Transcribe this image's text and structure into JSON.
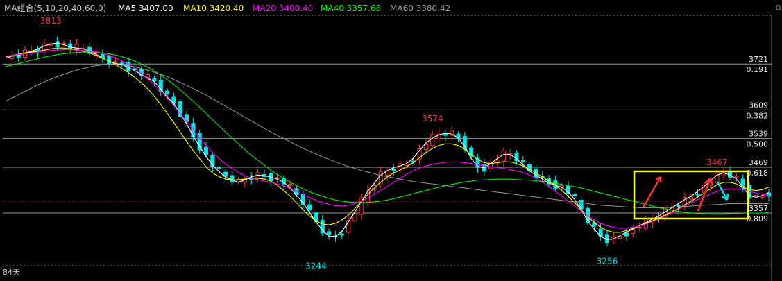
{
  "legend": {
    "title": "MA组合(5,10,20,40,60,0)",
    "items": [
      {
        "label": "MA5 3407.00",
        "color": "#ffffff"
      },
      {
        "label": "MA10 3420.40",
        "color": "#ffff00"
      },
      {
        "label": "MA20 3400.40",
        "color": "#ff00ff"
      },
      {
        "label": "MA40 3357.68",
        "color": "#00ff00"
      },
      {
        "label": "MA60 3380.42",
        "color": "#9a9a9a"
      }
    ]
  },
  "period_label": "84天",
  "colors": {
    "up": "#ff3232",
    "down": "#00e5e5",
    "grid": "#9a9a9a",
    "highlight": "#ffff00",
    "peak_label": "#ff3232",
    "trough_label": "#00e5e5"
  },
  "levels": [
    {
      "price": 3721,
      "ratio": "0.191"
    },
    {
      "price": 3609,
      "ratio": "0.382"
    },
    {
      "price": 3539,
      "ratio": "0.500"
    },
    {
      "price": 3469,
      "ratio": "0.618"
    },
    {
      "price": 3357,
      "ratio": "0.809"
    }
  ],
  "annotations": [
    {
      "text": "3813",
      "x": 8,
      "y": 3813,
      "kind": "peak"
    },
    {
      "text": "3574",
      "x": 67,
      "y": 3574,
      "kind": "peak"
    },
    {
      "text": "3467",
      "x": 111,
      "y": 3467,
      "kind": "peak"
    },
    {
      "text": "3244",
      "x": 49,
      "y": 3244,
      "kind": "trough"
    },
    {
      "text": "3256",
      "x": 94,
      "y": 3256,
      "kind": "trough"
    }
  ],
  "chart_data": {
    "type": "line",
    "title": "",
    "xlabel": "",
    "ylabel": "",
    "ylim": [
      3230,
      3840
    ],
    "grid": true,
    "legend_position": "top-left",
    "x": [
      1,
      2,
      3,
      4,
      5,
      6,
      7,
      8,
      9,
      10,
      11,
      12,
      13,
      14,
      15,
      16,
      17,
      18,
      19,
      20,
      21,
      22,
      23,
      24,
      25,
      26,
      27,
      28,
      29,
      30,
      31,
      32,
      33,
      34,
      35,
      36,
      37,
      38,
      39,
      40,
      41,
      42,
      43,
      44,
      45,
      46,
      47,
      48,
      49,
      50,
      51,
      52,
      53,
      54,
      55,
      56,
      57,
      58,
      59,
      60,
      61,
      62,
      63,
      64,
      65,
      66,
      67,
      68,
      69,
      70,
      71,
      72,
      73,
      74,
      75,
      76,
      77,
      78,
      79,
      80,
      81,
      82,
      83,
      84,
      85,
      86,
      87,
      88,
      89,
      90,
      91,
      92,
      93,
      94,
      95,
      96,
      97,
      98,
      99,
      100,
      101,
      102,
      103,
      104,
      105,
      106,
      107,
      108,
      109,
      110,
      111,
      112,
      113,
      114,
      115,
      116,
      117,
      118,
      119
    ],
    "series": [
      {
        "name": "MA5",
        "values": [
          3735,
          3740,
          3742,
          3748,
          3752,
          3758,
          3765,
          3770,
          3772,
          3768,
          3762,
          3760,
          3758,
          3752,
          3745,
          3735,
          3728,
          3722,
          3720,
          3712,
          3705,
          3695,
          3686,
          3678,
          3660,
          3640,
          3625,
          3600,
          3575,
          3545,
          3520,
          3495,
          3475,
          3458,
          3445,
          3438,
          3432,
          3438,
          3445,
          3450,
          3448,
          3445,
          3440,
          3432,
          3418,
          3400,
          3382,
          3358,
          3335,
          3315,
          3300,
          3300,
          3312,
          3335,
          3360,
          3385,
          3410,
          3430,
          3450,
          3460,
          3468,
          3472,
          3478,
          3490,
          3510,
          3528,
          3540,
          3548,
          3552,
          3550,
          3540,
          3520,
          3490,
          3470,
          3468,
          3478,
          3490,
          3500,
          3500,
          3490,
          3475,
          3460,
          3450,
          3440,
          3430,
          3425,
          3420,
          3408,
          3390,
          3365,
          3338,
          3318,
          3300,
          3292,
          3294,
          3302,
          3310,
          3318,
          3326,
          3334,
          3342,
          3350,
          3360,
          3370,
          3380,
          3390,
          3398,
          3410,
          3422,
          3436,
          3450,
          3455,
          3450,
          3440,
          3420,
          3400,
          3395,
          3400,
          3407
        ]
      },
      {
        "name": "MA10",
        "values": [
          3738,
          3742,
          3745,
          3748,
          3750,
          3752,
          3755,
          3758,
          3760,
          3760,
          3758,
          3756,
          3752,
          3748,
          3742,
          3735,
          3728,
          3720,
          3710,
          3700,
          3688,
          3675,
          3660,
          3642,
          3622,
          3600,
          3578,
          3555,
          3532,
          3510,
          3490,
          3470,
          3455,
          3446,
          3440,
          3438,
          3438,
          3440,
          3442,
          3442,
          3440,
          3435,
          3425,
          3412,
          3398,
          3382,
          3365,
          3350,
          3338,
          3330,
          3328,
          3332,
          3340,
          3352,
          3368,
          3385,
          3402,
          3418,
          3432,
          3445,
          3455,
          3462,
          3470,
          3480,
          3492,
          3505,
          3515,
          3522,
          3526,
          3526,
          3522,
          3512,
          3500,
          3488,
          3480,
          3478,
          3480,
          3482,
          3482,
          3478,
          3472,
          3464,
          3455,
          3445,
          3435,
          3425,
          3412,
          3398,
          3382,
          3365,
          3348,
          3334,
          3322,
          3314,
          3310,
          3310,
          3314,
          3320,
          3326,
          3332,
          3338,
          3345,
          3352,
          3360,
          3368,
          3377,
          3386,
          3396,
          3406,
          3416,
          3426,
          3432,
          3432,
          3428,
          3420,
          3414,
          3412,
          3414,
          3420
        ]
      },
      {
        "name": "MA20",
        "values": [
          3740,
          3742,
          3744,
          3746,
          3748,
          3750,
          3752,
          3754,
          3755,
          3756,
          3756,
          3755,
          3754,
          3752,
          3750,
          3746,
          3742,
          3736,
          3728,
          3720,
          3710,
          3698,
          3685,
          3670,
          3655,
          3638,
          3620,
          3600,
          3580,
          3560,
          3540,
          3522,
          3505,
          3490,
          3477,
          3466,
          3456,
          3448,
          3442,
          3438,
          3435,
          3432,
          3428,
          3423,
          3417,
          3410,
          3402,
          3395,
          3388,
          3382,
          3378,
          3375,
          3374,
          3376,
          3380,
          3386,
          3393,
          3402,
          3412,
          3422,
          3432,
          3442,
          3452,
          3460,
          3467,
          3472,
          3476,
          3479,
          3481,
          3482,
          3482,
          3480,
          3478,
          3475,
          3472,
          3470,
          3468,
          3466,
          3463,
          3460,
          3456,
          3450,
          3442,
          3433,
          3422,
          3410,
          3398,
          3386,
          3374,
          3362,
          3350,
          3340,
          3332,
          3326,
          3322,
          3320,
          3320,
          3322,
          3325,
          3330,
          3336,
          3342,
          3350,
          3358,
          3366,
          3374,
          3382,
          3390,
          3397,
          3404,
          3410,
          3414,
          3416,
          3416,
          3414,
          3410,
          3406,
          3403,
          3400
        ]
      },
      {
        "name": "MA40",
        "values": [
          3715,
          3718,
          3722,
          3726,
          3730,
          3734,
          3738,
          3741,
          3744,
          3746,
          3748,
          3749,
          3750,
          3750,
          3749,
          3748,
          3746,
          3743,
          3739,
          3734,
          3728,
          3721,
          3713,
          3704,
          3694,
          3683,
          3671,
          3658,
          3644,
          3630,
          3615,
          3600,
          3585,
          3570,
          3555,
          3540,
          3526,
          3512,
          3498,
          3486,
          3474,
          3462,
          3451,
          3441,
          3432,
          3424,
          3416,
          3409,
          3403,
          3398,
          3393,
          3389,
          3386,
          3384,
          3383,
          3382,
          3383,
          3384,
          3386,
          3389,
          3392,
          3396,
          3400,
          3404,
          3408,
          3412,
          3416,
          3420,
          3424,
          3427,
          3430,
          3433,
          3435,
          3437,
          3438,
          3439,
          3440,
          3440,
          3440,
          3439,
          3438,
          3437,
          3436,
          3434,
          3432,
          3430,
          3427,
          3424,
          3421,
          3418,
          3414,
          3410,
          3406,
          3402,
          3398,
          3394,
          3390,
          3386,
          3382,
          3378,
          3374,
          3370,
          3367,
          3364,
          3361,
          3359,
          3357,
          3356,
          3355,
          3355,
          3355,
          3355,
          3356,
          3356,
          3357,
          3357,
          3357,
          3357,
          3358
        ]
      },
      {
        "name": "MA60",
        "values": [
          3630,
          3638,
          3646,
          3654,
          3662,
          3670,
          3677,
          3684,
          3690,
          3696,
          3701,
          3706,
          3710,
          3714,
          3717,
          3719,
          3720,
          3720,
          3719,
          3717,
          3714,
          3710,
          3706,
          3701,
          3696,
          3690,
          3683,
          3676,
          3669,
          3661,
          3653,
          3645,
          3636,
          3627,
          3618,
          3609,
          3600,
          3591,
          3582,
          3573,
          3564,
          3555,
          3547,
          3539,
          3531,
          3523,
          3515,
          3508,
          3501,
          3494,
          3488,
          3482,
          3476,
          3471,
          3466,
          3461,
          3457,
          3453,
          3449,
          3446,
          3443,
          3440,
          3437,
          3434,
          3432,
          3430,
          3428,
          3426,
          3424,
          3422,
          3420,
          3418,
          3416,
          3414,
          3412,
          3410,
          3408,
          3406,
          3404,
          3402,
          3400,
          3398,
          3396,
          3394,
          3392,
          3390,
          3388,
          3386,
          3384,
          3382,
          3380,
          3378,
          3376,
          3375,
          3374,
          3373,
          3372,
          3371,
          3370,
          3370,
          3370,
          3370,
          3370,
          3371,
          3372,
          3373,
          3374,
          3375,
          3376,
          3377,
          3378,
          3379,
          3380,
          3380,
          3380,
          3380,
          3380,
          3380,
          3380
        ]
      }
    ]
  }
}
